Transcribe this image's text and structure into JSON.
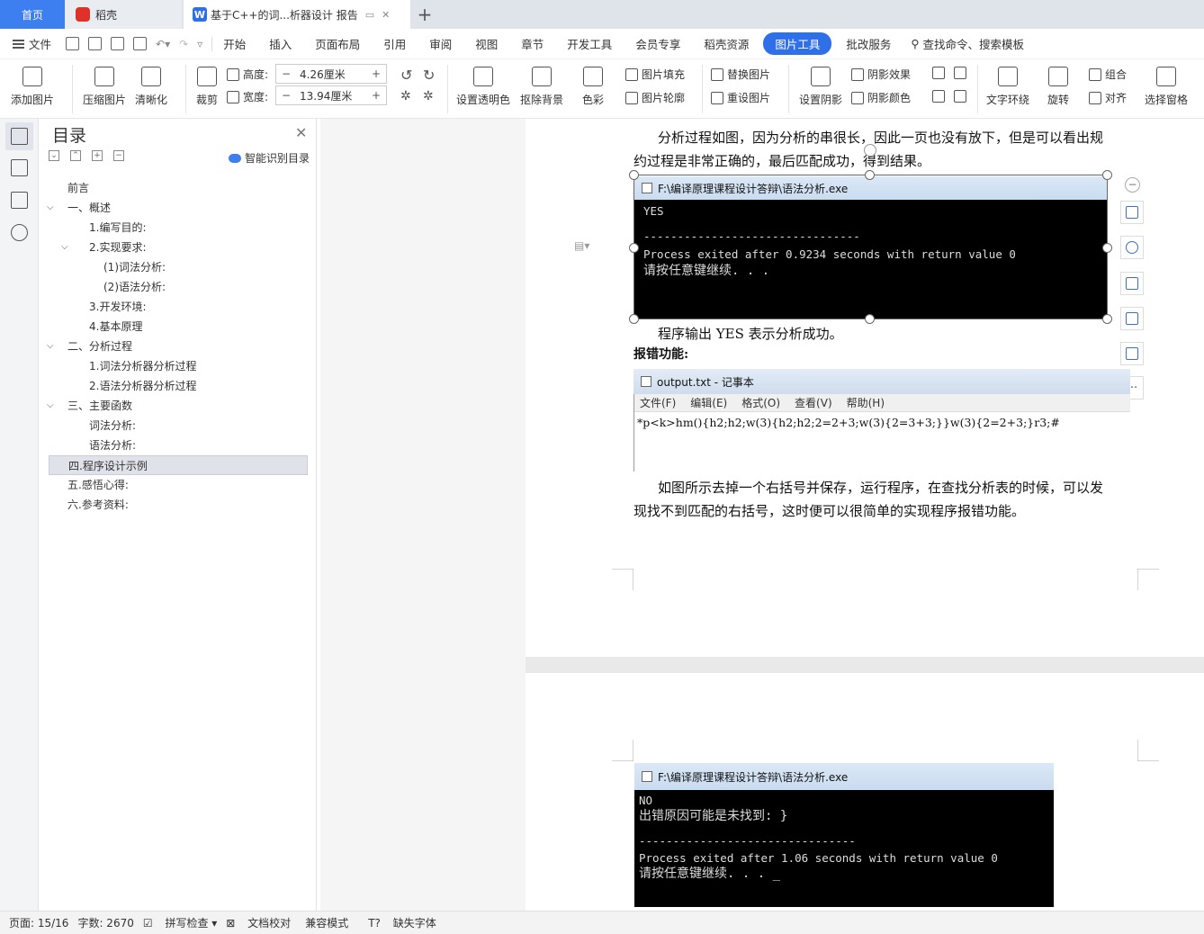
{
  "tabs": {
    "home": "首页",
    "daoke": "稻壳",
    "doc": "基于C++的词...析器设计 报告",
    "plus": "+"
  },
  "menu": {
    "file": "文件",
    "items": [
      "开始",
      "插入",
      "页面布局",
      "引用",
      "审阅",
      "视图",
      "章节",
      "开发工具",
      "会员专享",
      "稻壳资源"
    ],
    "active": "图片工具",
    "review": "批改服务",
    "search": "查找命令、搜索模板"
  },
  "ribbon": {
    "add_image": "添加图片",
    "compress": "压缩图片",
    "sharpen": "清晰化",
    "crop": "裁剪",
    "height_label": "高度:",
    "height_value": "4.26厘米",
    "width_label": "宽度:",
    "width_value": "13.94厘米",
    "transparent": "设置透明色",
    "remove_bg": "抠除背景",
    "color": "色彩",
    "fill": "图片填充",
    "outline": "图片轮廓",
    "replace": "替换图片",
    "reset": "重设图片",
    "shadow_set": "设置阴影",
    "shadow_effect": "阴影效果",
    "shadow_color": "阴影颜色",
    "wrap": "文字环绕",
    "rotate": "旋转",
    "group": "组合",
    "align": "对齐",
    "select_pane": "选择窗格"
  },
  "toc": {
    "title": "目录",
    "smart": "智能识别目录",
    "items": [
      {
        "label": "前言",
        "level": 0,
        "arrow": ""
      },
      {
        "label": "一、概述",
        "level": 0,
        "arrow": "v"
      },
      {
        "label": "1.编写目的:",
        "level": 1,
        "arrow": ""
      },
      {
        "label": "2.实现要求:",
        "level": 1,
        "arrow": "v"
      },
      {
        "label": "(1)词法分析:",
        "level": 2,
        "arrow": ""
      },
      {
        "label": "(2)语法分析:",
        "level": 2,
        "arrow": ""
      },
      {
        "label": "3.开发环境:",
        "level": 1,
        "arrow": ""
      },
      {
        "label": "4.基本原理",
        "level": 1,
        "arrow": ""
      },
      {
        "label": "二、分析过程",
        "level": 0,
        "arrow": "v"
      },
      {
        "label": "1.词法分析器分析过程",
        "level": 1,
        "arrow": ""
      },
      {
        "label": "2.语法分析器分析过程",
        "level": 1,
        "arrow": ""
      },
      {
        "label": "三、主要函数",
        "level": 0,
        "arrow": "v"
      },
      {
        "label": "词法分析:",
        "level": 1,
        "arrow": ""
      },
      {
        "label": "语法分析:",
        "level": 1,
        "arrow": ""
      },
      {
        "label": "四.程序设计示例",
        "level": 0,
        "arrow": "",
        "selected": true
      },
      {
        "label": "五.感悟心得:",
        "level": 0,
        "arrow": ""
      },
      {
        "label": "六.参考资料:",
        "level": 0,
        "arrow": ""
      }
    ]
  },
  "doc": {
    "para1_line1": "分析过程如图，因为分析的串很长，因此一页也没有放下，但是可以看出规",
    "para1_line2": "约过程是非常正确的，最后匹配成功，得到结果。",
    "console1_title": "F:\\编译原理课程设计答辩\\语法分析.exe",
    "console1_lines": [
      "YES",
      "",
      "--------------------------------",
      "Process exited after 0.9234 seconds with return value 0",
      "请按任意键继续. . ."
    ],
    "para2": "程序输出 YES 表示分析成功。",
    "heading": "报错功能:",
    "notepad_title": "output.txt - 记事本",
    "notepad_menu": [
      "文件(F)",
      "编辑(E)",
      "格式(O)",
      "查看(V)",
      "帮助(H)"
    ],
    "notepad_content": "*p<k>hm(){h2;h2;w(3){h2;h2;2=2+3;w(3){2=3+3;}}w(3){2=2+3;}r3;#",
    "para3_line1": "如图所示去掉一个右括号并保存，运行程序，在查找分析表的时候，可以发",
    "para3_line2": "现找不到匹配的右括号，这时便可以很简单的实现程序报错功能。",
    "console2_title": "F:\\编译原理课程设计答辩\\语法分析.exe",
    "console2_lines": [
      "NO",
      "出错原因可能是未找到: }",
      "",
      "--------------------------------",
      "Process exited after 1.06 seconds with return value 0",
      "请按任意键继续. . . _"
    ]
  },
  "status": {
    "page": "页面: 15/16",
    "words": "字数: 2670",
    "spell": "拼写检查",
    "proof": "文档校对",
    "compat": "兼容模式",
    "missing_font": "缺失字体"
  }
}
